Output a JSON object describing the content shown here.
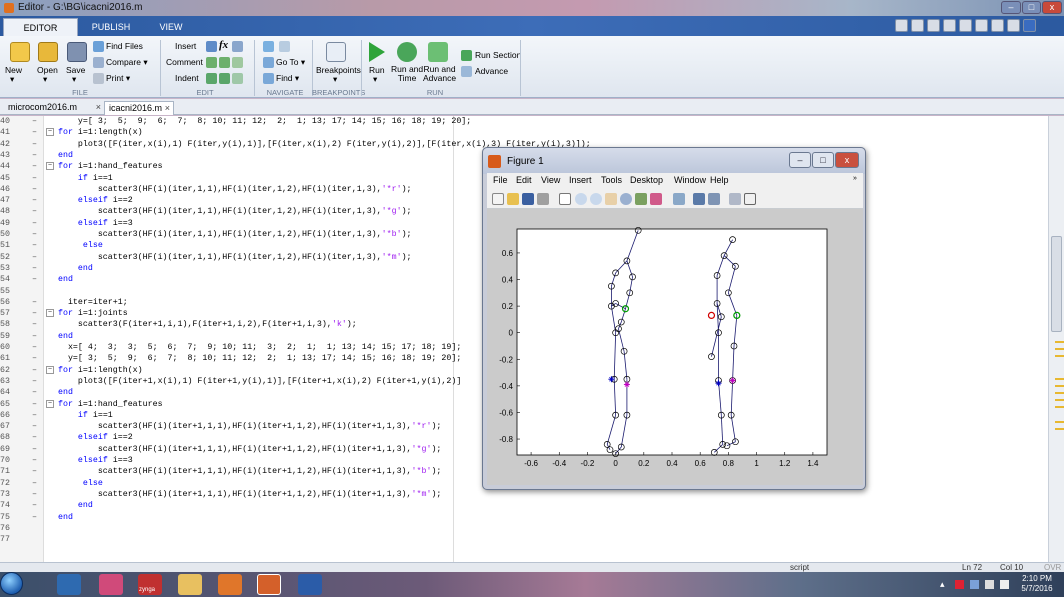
{
  "window": {
    "title": "Editor - G:\\BG\\icacni2016.m",
    "min": "–",
    "max": "□",
    "close": "x"
  },
  "tabs": {
    "editor": "EDITOR",
    "publish": "PUBLISH",
    "view": "VIEW"
  },
  "ribbon": {
    "new": "New",
    "open": "Open",
    "save": "Save",
    "find_files": "Find Files",
    "compare": "Compare ▾",
    "print": "Print ▾",
    "insert": "Insert",
    "comment": "Comment",
    "indent": "Indent",
    "go_to": "Go To ▾",
    "find": "Find ▾",
    "breakpoints": "Breakpoints",
    "run": "Run",
    "run_and_time": "Run and\nTime",
    "run_and_advance": "Run and\nAdvance",
    "run_section": "Run Section",
    "advance": "Advance",
    "groups": {
      "file": "FILE",
      "edit": "EDIT",
      "navigate": "NAVIGATE",
      "breakpoints": "BREAKPOINTS",
      "run": "RUN"
    }
  },
  "files": [
    {
      "name": "microcom2016.m",
      "close": "×"
    },
    {
      "name": "icacni2016.m",
      "close": "×"
    }
  ],
  "code_lines": [
    {
      "n": "40",
      "d": "–",
      "fold": "",
      "text": "    y=[ 3;  5;  9;  6;  7;  8; 10; 11; 12;  2;  1; 13; 17; 14; 15; 16; 18; 19; 20];"
    },
    {
      "n": "41",
      "d": "–",
      "fold": "−",
      "text": "for i=1:length(x)"
    },
    {
      "n": "42",
      "d": "–",
      "fold": "",
      "text": "    plot3([F(iter,x(i),1) F(iter,y(i),1)],[F(iter,x(i),2) F(iter,y(i),2)],[F(iter,x(i),3) F(iter,y(i),3)]);"
    },
    {
      "n": "43",
      "d": "–",
      "fold": "",
      "text": "end"
    },
    {
      "n": "44",
      "d": "–",
      "fold": "−",
      "text": "for i=1:hand_features"
    },
    {
      "n": "45",
      "d": "–",
      "fold": "",
      "text": "    if i==1"
    },
    {
      "n": "46",
      "d": "–",
      "fold": "",
      "text": "        scatter3(HF(i)(iter,1,1),HF(i)(iter,1,2),HF(i)(iter,1,3),'*r');"
    },
    {
      "n": "47",
      "d": "–",
      "fold": "",
      "text": "    elseif i==2"
    },
    {
      "n": "48",
      "d": "–",
      "fold": "",
      "text": "        scatter3(HF(i)(iter,1,1),HF(i)(iter,1,2),HF(i)(iter,1,3),'*g');"
    },
    {
      "n": "49",
      "d": "–",
      "fold": "",
      "text": "    elseif i==3"
    },
    {
      "n": "50",
      "d": "–",
      "fold": "",
      "text": "        scatter3(HF(i)(iter,1,1),HF(i)(iter,1,2),HF(i)(iter,1,3),'*b');"
    },
    {
      "n": "51",
      "d": "–",
      "fold": "",
      "text": "     else"
    },
    {
      "n": "52",
      "d": "–",
      "fold": "",
      "text": "        scatter3(HF(i)(iter,1,1),HF(i)(iter,1,2),HF(i)(iter,1,3),'*m');"
    },
    {
      "n": "53",
      "d": "–",
      "fold": "",
      "text": "    end"
    },
    {
      "n": "54",
      "d": "–",
      "fold": "",
      "text": "end"
    },
    {
      "n": "55",
      "d": "",
      "fold": "",
      "text": ""
    },
    {
      "n": "56",
      "d": "–",
      "fold": "",
      "text": "  iter=iter+1;"
    },
    {
      "n": "57",
      "d": "–",
      "fold": "−",
      "text": "for i=1:joints"
    },
    {
      "n": "58",
      "d": "–",
      "fold": "",
      "text": "    scatter3(F(iter+1,i,1),F(iter+1,i,2),F(iter+1,i,3),'k');"
    },
    {
      "n": "59",
      "d": "–",
      "fold": "",
      "text": "end"
    },
    {
      "n": "60",
      "d": "–",
      "fold": "",
      "text": "  x=[ 4;  3;  3;  5;  6;  7;  9; 10; 11;  3;  2;  1;  1; 13; 14; 15; 17; 18; 19];"
    },
    {
      "n": "61",
      "d": "–",
      "fold": "",
      "text": "  y=[ 3;  5;  9;  6;  7;  8; 10; 11; 12;  2;  1; 13; 17; 14; 15; 16; 18; 19; 20];"
    },
    {
      "n": "62",
      "d": "–",
      "fold": "−",
      "text": "for i=1:length(x)"
    },
    {
      "n": "63",
      "d": "–",
      "fold": "",
      "text": "    plot3([F(iter+1,x(i),1) F(iter+1,y(i),1)],[F(iter+1,x(i),2) F(iter+1,y(i),2)]"
    },
    {
      "n": "64",
      "d": "–",
      "fold": "",
      "text": "end"
    },
    {
      "n": "65",
      "d": "–",
      "fold": "−",
      "text": "for i=1:hand_features"
    },
    {
      "n": "66",
      "d": "–",
      "fold": "",
      "text": "    if i==1"
    },
    {
      "n": "67",
      "d": "–",
      "fold": "",
      "text": "        scatter3(HF(i)(iter+1,1,1),HF(i)(iter+1,1,2),HF(i)(iter+1,1,3),'*r');"
    },
    {
      "n": "68",
      "d": "–",
      "fold": "",
      "text": "    elseif i==2"
    },
    {
      "n": "69",
      "d": "–",
      "fold": "",
      "text": "        scatter3(HF(i)(iter+1,1,1),HF(i)(iter+1,1,2),HF(i)(iter+1,1,3),'*g');"
    },
    {
      "n": "70",
      "d": "–",
      "fold": "",
      "text": "    elseif i==3"
    },
    {
      "n": "71",
      "d": "–",
      "fold": "",
      "text": "        scatter3(HF(i)(iter+1,1,1),HF(i)(iter+1,1,2),HF(i)(iter+1,1,3),'*b');"
    },
    {
      "n": "72",
      "d": "–",
      "fold": "",
      "text": "     else"
    },
    {
      "n": "73",
      "d": "–",
      "fold": "",
      "text": "        scatter3(HF(i)(iter+1,1,1),HF(i)(iter+1,1,2),HF(i)(iter+1,1,3),'*m');"
    },
    {
      "n": "74",
      "d": "–",
      "fold": "",
      "text": "    end"
    },
    {
      "n": "75",
      "d": "–",
      "fold": "",
      "text": "end"
    },
    {
      "n": "76",
      "d": "",
      "fold": "",
      "text": ""
    },
    {
      "n": "77",
      "d": "",
      "fold": "",
      "text": ""
    }
  ],
  "status": {
    "mode": "script",
    "ln": "Ln  72",
    "col": "Col  10",
    "ovr": "OVR"
  },
  "taskbar": {
    "time": "2:10 PM",
    "date": "5/7/2016",
    "zynga": "zynga"
  },
  "figure": {
    "title": "Figure 1",
    "menu": [
      "File",
      "Edit",
      "View",
      "Insert",
      "Tools",
      "Desktop",
      "Window",
      "Help"
    ],
    "min": "–",
    "max": "□",
    "close": "x"
  },
  "chart_data": {
    "type": "line",
    "title": "",
    "xlabel": "",
    "ylabel": "",
    "xlim": [
      -0.7,
      1.5
    ],
    "ylim": [
      -0.92,
      0.78
    ],
    "xticks": [
      "-0.6",
      "-0.4",
      "-0.2",
      "0",
      "0.2",
      "0.4",
      "0.6",
      "0.8",
      "1",
      "1.2",
      "1.4"
    ],
    "yticks": [
      "0.6",
      "0.4",
      "0.2",
      "0",
      "-0.2",
      "-0.4",
      "-0.6",
      "-0.8"
    ],
    "xtick_values": [
      -0.6,
      -0.4,
      -0.2,
      0,
      0.2,
      0.4,
      0.6,
      0.8,
      1,
      1.2,
      1.4
    ],
    "ytick_values": [
      0.6,
      0.4,
      0.2,
      0,
      -0.2,
      -0.4,
      -0.6,
      -0.8
    ],
    "series": [
      {
        "segments": [
          [
            [
              0.16,
              0.77
            ],
            [
              0.08,
              0.54
            ]
          ],
          [
            [
              0.08,
              0.54
            ],
            [
              0.12,
              0.42
            ]
          ],
          [
            [
              0.08,
              0.54
            ],
            [
              0.0,
              0.45
            ]
          ],
          [
            [
              0.0,
              0.45
            ],
            [
              -0.03,
              0.35
            ]
          ],
          [
            [
              -0.03,
              0.35
            ],
            [
              -0.03,
              0.2
            ]
          ],
          [
            [
              -0.03,
              0.2
            ],
            [
              0.0,
              0.0
            ]
          ],
          [
            [
              0.12,
              0.42
            ],
            [
              0.1,
              0.3
            ]
          ],
          [
            [
              0.1,
              0.3
            ],
            [
              0.07,
              0.18
            ]
          ],
          [
            [
              0.07,
              0.18
            ],
            [
              0.04,
              0.08
            ]
          ],
          [
            [
              -0.03,
              0.2
            ],
            [
              0.0,
              0.22
            ]
          ],
          [
            [
              0.0,
              0.22
            ],
            [
              0.07,
              0.18
            ]
          ],
          [
            [
              0.0,
              0.0
            ],
            [
              -0.01,
              -0.35
            ]
          ],
          [
            [
              -0.01,
              -0.35
            ],
            [
              0.0,
              -0.62
            ]
          ],
          [
            [
              0.0,
              -0.62
            ],
            [
              -0.06,
              -0.84
            ]
          ],
          [
            [
              0.04,
              0.08
            ],
            [
              0.02,
              0.03
            ]
          ],
          [
            [
              0.02,
              0.03
            ],
            [
              0.06,
              -0.14
            ]
          ],
          [
            [
              0.06,
              -0.14
            ],
            [
              0.08,
              -0.35
            ]
          ],
          [
            [
              0.08,
              -0.35
            ],
            [
              0.08,
              -0.62
            ]
          ],
          [
            [
              0.08,
              -0.62
            ],
            [
              0.04,
              -0.86
            ]
          ],
          [
            [
              -0.06,
              -0.84
            ],
            [
              -0.04,
              -0.88
            ]
          ],
          [
            [
              0.04,
              -0.86
            ],
            [
              0.0,
              -0.91
            ]
          ]
        ],
        "points": [
          [
            0.16,
            0.77
          ],
          [
            0.08,
            0.54
          ],
          [
            0.0,
            0.45
          ],
          [
            0.12,
            0.42
          ],
          [
            -0.03,
            0.35
          ],
          [
            0.1,
            0.3
          ],
          [
            -0.03,
            0.2
          ],
          [
            0.0,
            0.22
          ],
          [
            0.07,
            0.18
          ],
          [
            0.04,
            0.08
          ],
          [
            0.02,
            0.03
          ],
          [
            0.0,
            0.0
          ],
          [
            0.06,
            -0.14
          ],
          [
            -0.01,
            -0.35
          ],
          [
            0.08,
            -0.35
          ],
          [
            0.0,
            -0.62
          ],
          [
            0.08,
            -0.62
          ],
          [
            -0.06,
            -0.84
          ],
          [
            0.04,
            -0.86
          ],
          [
            -0.04,
            -0.88
          ],
          [
            0.0,
            -0.91
          ]
        ]
      },
      {
        "segments": [
          [
            [
              0.83,
              0.7
            ],
            [
              0.77,
              0.58
            ]
          ],
          [
            [
              0.77,
              0.58
            ],
            [
              0.72,
              0.43
            ]
          ],
          [
            [
              0.77,
              0.58
            ],
            [
              0.85,
              0.5
            ]
          ],
          [
            [
              0.72,
              0.43
            ],
            [
              0.72,
              0.22
            ]
          ],
          [
            [
              0.72,
              0.22
            ],
            [
              0.73,
              0.0
            ]
          ],
          [
            [
              0.85,
              0.5
            ],
            [
              0.8,
              0.3
            ]
          ],
          [
            [
              0.8,
              0.3
            ],
            [
              0.86,
              0.13
            ]
          ],
          [
            [
              0.86,
              0.13
            ],
            [
              0.84,
              -0.1
            ]
          ],
          [
            [
              0.72,
              0.22
            ],
            [
              0.75,
              0.12
            ]
          ],
          [
            [
              0.75,
              0.12
            ],
            [
              0.68,
              -0.18
            ]
          ],
          [
            [
              0.73,
              0.0
            ],
            [
              0.73,
              -0.36
            ]
          ],
          [
            [
              0.73,
              -0.36
            ],
            [
              0.75,
              -0.62
            ]
          ],
          [
            [
              0.75,
              -0.62
            ],
            [
              0.76,
              -0.84
            ]
          ],
          [
            [
              0.84,
              -0.1
            ],
            [
              0.83,
              -0.36
            ]
          ],
          [
            [
              0.83,
              -0.36
            ],
            [
              0.82,
              -0.62
            ]
          ],
          [
            [
              0.82,
              -0.62
            ],
            [
              0.85,
              -0.82
            ]
          ],
          [
            [
              0.76,
              -0.84
            ],
            [
              0.7,
              -0.9
            ]
          ],
          [
            [
              0.85,
              -0.82
            ],
            [
              0.79,
              -0.85
            ]
          ]
        ],
        "points": [
          [
            0.83,
            0.7
          ],
          [
            0.77,
            0.58
          ],
          [
            0.85,
            0.5
          ],
          [
            0.72,
            0.43
          ],
          [
            0.8,
            0.3
          ],
          [
            0.72,
            0.22
          ],
          [
            0.75,
            0.12
          ],
          [
            0.86,
            0.13
          ],
          [
            0.73,
            0.0
          ],
          [
            0.84,
            -0.1
          ],
          [
            0.68,
            -0.18
          ],
          [
            0.73,
            -0.36
          ],
          [
            0.83,
            -0.36
          ],
          [
            0.75,
            -0.62
          ],
          [
            0.82,
            -0.62
          ],
          [
            0.76,
            -0.84
          ],
          [
            0.85,
            -0.82
          ],
          [
            0.7,
            -0.9
          ],
          [
            0.79,
            -0.85
          ]
        ]
      }
    ],
    "markers": [
      {
        "x": 0.07,
        "y": 0.18,
        "color": "#00a000",
        "style": "circle"
      },
      {
        "x": 0.86,
        "y": 0.13,
        "color": "#00a000",
        "style": "circle"
      },
      {
        "x": 0.68,
        "y": 0.13,
        "color": "#d00000",
        "style": "circle"
      },
      {
        "x": -0.03,
        "y": -0.35,
        "color": "#0000c0",
        "style": "star"
      },
      {
        "x": 0.73,
        "y": -0.38,
        "color": "#0000c0",
        "style": "star"
      },
      {
        "x": 0.08,
        "y": -0.39,
        "color": "#c000c0",
        "style": "star"
      },
      {
        "x": 0.83,
        "y": -0.36,
        "color": "#c000c0",
        "style": "star"
      }
    ],
    "line_color": "#1a1a6e"
  }
}
